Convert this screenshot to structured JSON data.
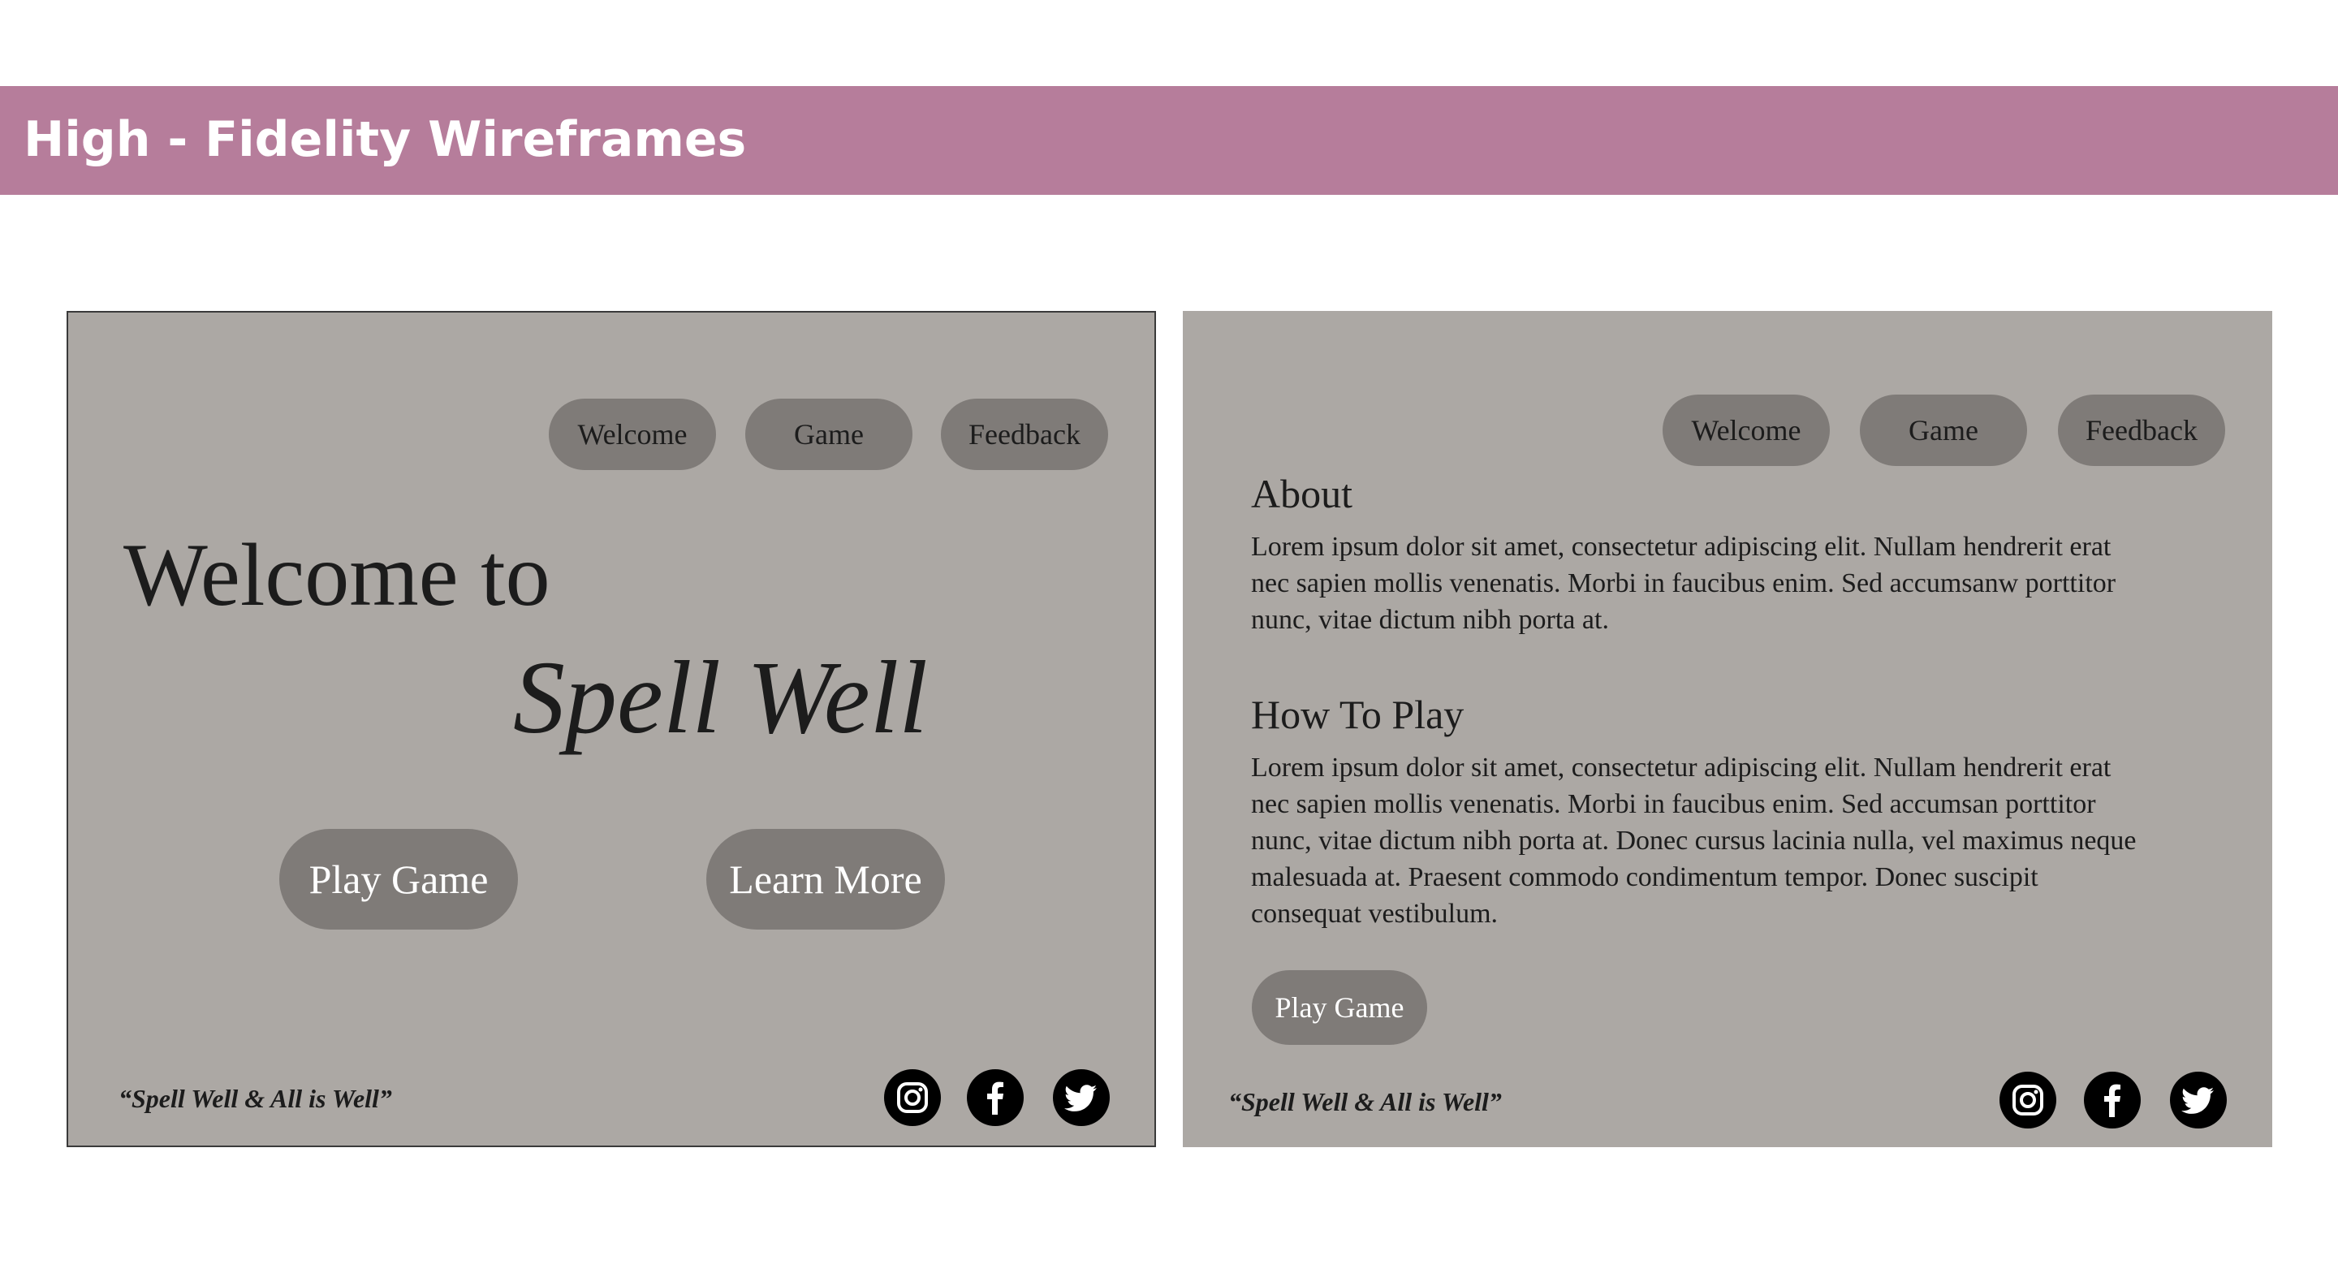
{
  "header": {
    "title": "High - Fidelity Wireframes",
    "color": "#b67d9b"
  },
  "colors": {
    "frame_bg": "#aca8a4",
    "pill_bg": "#7f7b78",
    "text_dark": "#1c1c1c"
  },
  "welcome_screen": {
    "nav": [
      "Welcome",
      "Game",
      "Feedback"
    ],
    "welcome_line": "Welcome to",
    "brand_line": "Spell Well",
    "buttons": {
      "play": "Play Game",
      "learn": "Learn More"
    },
    "tagline": "“Spell Well & All is Well”",
    "social_icons": [
      "instagram-icon",
      "facebook-icon",
      "twitter-icon"
    ]
  },
  "about_screen": {
    "nav": [
      "Welcome",
      "Game",
      "Feedback"
    ],
    "about": {
      "heading": "About",
      "body": "Lorem ipsum dolor sit amet, consectetur adipiscing elit. Nullam hendrerit erat nec sapien mollis venenatis. Morbi in faucibus enim. Sed accumsanw porttitor nunc, vitae dictum nibh porta at."
    },
    "how_to_play": {
      "heading": "How To Play",
      "body": "Lorem ipsum dolor sit amet, consectetur adipiscing elit. Nullam hendrerit erat nec sapien mollis venenatis. Morbi in faucibus enim. Sed accumsan porttitor nunc, vitae dictum nibh porta at. Donec cursus lacinia nulla, vel maximus neque malesuada at. Praesent commodo condimentum tempor. Donec suscipit consequat vestibulum."
    },
    "play_button": "Play Game",
    "tagline": "“Spell Well & All is Well”",
    "social_icons": [
      "instagram-icon",
      "facebook-icon",
      "twitter-icon"
    ]
  }
}
